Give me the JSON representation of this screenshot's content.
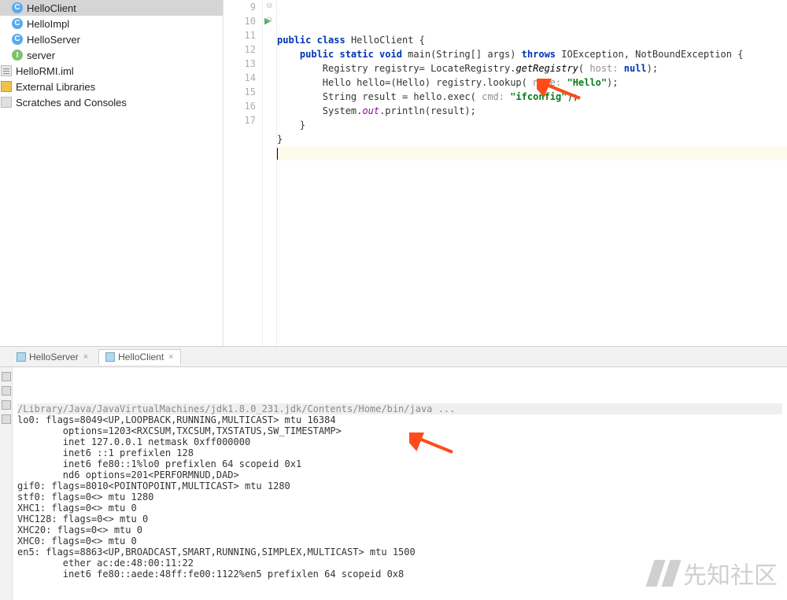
{
  "sidebar": {
    "items": [
      {
        "label": "HelloClient",
        "icon": "class",
        "level": 1,
        "selected": true
      },
      {
        "label": "HelloImpl",
        "icon": "class",
        "level": 1,
        "selected": false
      },
      {
        "label": "HelloServer",
        "icon": "class",
        "level": 1,
        "selected": false
      },
      {
        "label": "server",
        "icon": "interface",
        "level": 1,
        "selected": false
      },
      {
        "label": "HelloRMI.iml",
        "icon": "xml",
        "level": 0,
        "selected": false
      },
      {
        "label": "External Libraries",
        "icon": "lib",
        "level": -1,
        "selected": false
      },
      {
        "label": "Scratches and Consoles",
        "icon": "scratch",
        "level": -1,
        "selected": false
      }
    ]
  },
  "editor": {
    "first_line_no": 9,
    "lines": [
      {
        "n": 9,
        "raw": "public class HelloClient {",
        "tokens": [
          [
            "kw",
            "public"
          ],
          [
            "",
            " "
          ],
          [
            "kw",
            "class"
          ],
          [
            "",
            " HelloClient {"
          ]
        ]
      },
      {
        "n": 10,
        "run": true,
        "raw": "    public static void main(String[] args) throws IOException, NotBoundException {",
        "tokens": [
          [
            "",
            "    "
          ],
          [
            "kw",
            "public static void"
          ],
          [
            "",
            " main(String[] args) "
          ],
          [
            "kw",
            "throws"
          ],
          [
            "",
            " IOException, NotBoundException {"
          ]
        ]
      },
      {
        "n": 11,
        "raw": "        Registry registry= LocateRegistry.getRegistry( host: null);",
        "tokens": [
          [
            "",
            "        Registry registry= LocateRegistry."
          ],
          [
            "mth",
            "getRegistry"
          ],
          [
            "",
            "( "
          ],
          [
            "hint",
            "host: "
          ],
          [
            "kw",
            "null"
          ],
          [
            "",
            ");"
          ]
        ]
      },
      {
        "n": 12,
        "raw": "        Hello hello=(Hello) registry.lookup( name: \"Hello\");",
        "tokens": [
          [
            "",
            "        Hello hello=(Hello) registry.lookup( "
          ],
          [
            "hint",
            "name: "
          ],
          [
            "str",
            "\"Hello\""
          ],
          [
            "",
            ");"
          ]
        ]
      },
      {
        "n": 13,
        "raw": "        String result = hello.exec( cmd: \"ifconfig\");",
        "tokens": [
          [
            "",
            "        String result = hello.exec( "
          ],
          [
            "hint",
            "cmd: "
          ],
          [
            "str",
            "\"ifconfig\""
          ],
          [
            "",
            ");"
          ]
        ]
      },
      {
        "n": 14,
        "raw": "        System.out.println(result);",
        "tokens": [
          [
            "",
            "        System."
          ],
          [
            "fld",
            "out"
          ],
          [
            "",
            ".println(result);"
          ]
        ]
      },
      {
        "n": 15,
        "raw": "    }",
        "tokens": [
          [
            "",
            "    }"
          ]
        ]
      },
      {
        "n": 16,
        "raw": "}",
        "tokens": [
          [
            "",
            "}"
          ]
        ]
      },
      {
        "n": 17,
        "raw": "",
        "tokens": [],
        "caret": true,
        "highlight": true
      }
    ]
  },
  "run_panel": {
    "tabs": [
      {
        "label": "HelloServer",
        "active": false
      },
      {
        "label": "HelloClient",
        "active": true
      }
    ],
    "command": "/Library/Java/JavaVirtualMachines/jdk1.8.0_231.jdk/Contents/Home/bin/java ...",
    "output": [
      "lo0: flags=8049<UP,LOOPBACK,RUNNING,MULTICAST> mtu 16384",
      "\toptions=1203<RXCSUM,TXCSUM,TXSTATUS,SW_TIMESTAMP>",
      "\tinet 127.0.0.1 netmask 0xff000000",
      "\tinet6 ::1 prefixlen 128",
      "\tinet6 fe80::1%lo0 prefixlen 64 scopeid 0x1",
      "\tnd6 options=201<PERFORMNUD,DAD>",
      "gif0: flags=8010<POINTOPOINT,MULTICAST> mtu 1280",
      "stf0: flags=0<> mtu 1280",
      "XHC1: flags=0<> mtu 0",
      "VHC128: flags=0<> mtu 0",
      "XHC20: flags=0<> mtu 0",
      "XHC0: flags=0<> mtu 0",
      "en5: flags=8863<UP,BROADCAST,SMART,RUNNING,SIMPLEX,MULTICAST> mtu 1500",
      "\tether ac:de:48:00:11:22",
      "\tinet6 fe80::aede:48ff:fe00:1122%en5 prefixlen 64 scopeid 0x8"
    ]
  },
  "watermark": "先知社区"
}
